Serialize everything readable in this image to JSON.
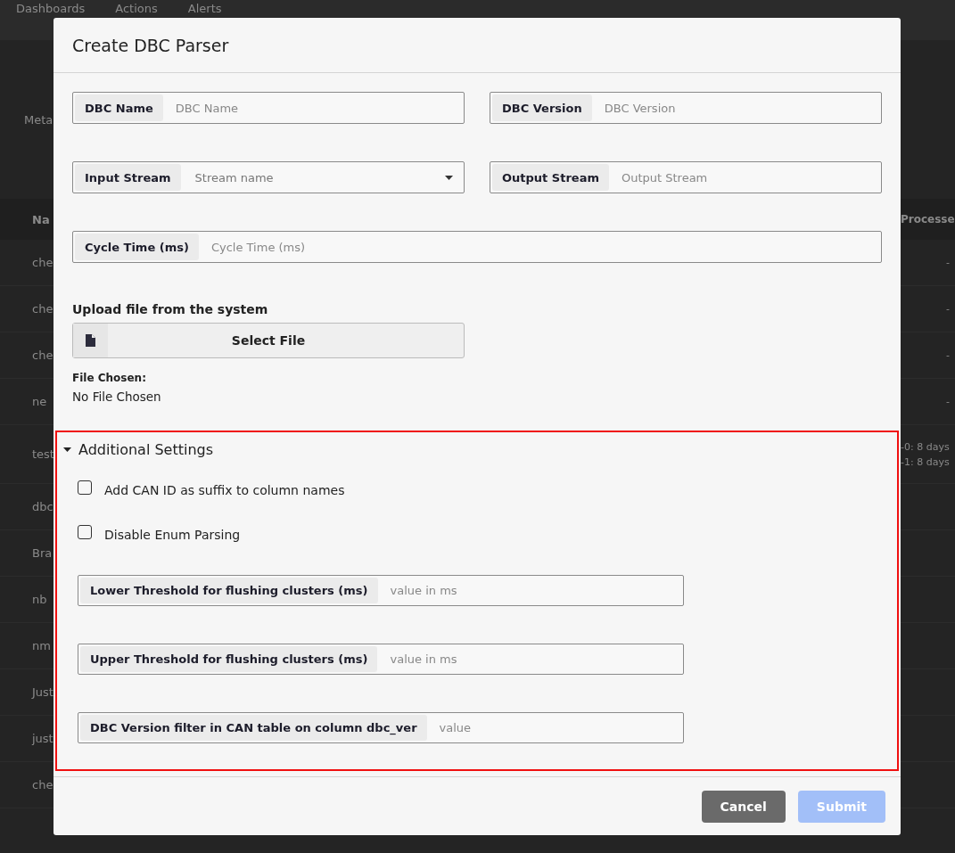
{
  "background": {
    "nav": [
      "Dashboards",
      "Actions",
      "Alerts"
    ],
    "side_label": "Meta",
    "table": {
      "columns": [
        "Na",
        "Processe"
      ],
      "rows": [
        {
          "column_1": "che",
          "column_2": [
            "-"
          ]
        },
        {
          "column_1": "che",
          "column_2": [
            "-"
          ]
        },
        {
          "column_1": "che",
          "column_2": [
            "-"
          ]
        },
        {
          "column_1": "ne",
          "column_2": [
            "-"
          ]
        },
        {
          "column_1": "test",
          "column_2": [
            "-0: 8 days",
            "-1: 8 days"
          ]
        },
        {
          "column_1": "dbc"
        },
        {
          "column_1": "Bra"
        },
        {
          "column_1": "nb"
        },
        {
          "column_1": "nm"
        },
        {
          "column_1": "Just"
        },
        {
          "column_1": "just"
        },
        {
          "column_1": "che"
        }
      ]
    }
  },
  "dialog": {
    "title": "Create DBC Parser",
    "field_rows": [
      [
        {
          "kind": "text",
          "label": "DBC Name",
          "placeholder": "DBC Name"
        },
        {
          "kind": "text",
          "label": "DBC Version",
          "placeholder": "DBC Version"
        }
      ],
      [
        {
          "kind": "select",
          "label": "Input Stream",
          "placeholder": "Stream name"
        },
        {
          "kind": "text",
          "label": "Output Stream",
          "placeholder": "Output Stream"
        }
      ],
      [
        {
          "kind": "text",
          "label": "Cycle Time (ms)",
          "placeholder": "Cycle Time (ms)"
        }
      ]
    ],
    "upload": {
      "label": "Upload file from the system",
      "button": "Select File",
      "chosen_label": "File Chosen:",
      "chosen_value": "No File Chosen"
    },
    "additional_settings": {
      "title": "Additional Settings",
      "expanded": true,
      "highlighted": true,
      "checkboxes": [
        {
          "label": "Add CAN ID as suffix to column names",
          "checked": false
        },
        {
          "label": "Disable Enum Parsing",
          "checked": false
        }
      ],
      "fields": [
        {
          "kind": "text",
          "label": "Lower Threshold for flushing clusters (ms)",
          "placeholder": "value in ms"
        },
        {
          "kind": "text",
          "label": "Upper Threshold for flushing clusters (ms)",
          "placeholder": "value in ms"
        },
        {
          "kind": "text",
          "label": "DBC Version filter in CAN table on column dbc_ver",
          "placeholder": "value"
        }
      ]
    },
    "buttons": [
      {
        "label": "Cancel",
        "kind": "secondary",
        "disabled": false
      },
      {
        "label": "Submit",
        "kind": "primary",
        "disabled": true
      }
    ]
  }
}
